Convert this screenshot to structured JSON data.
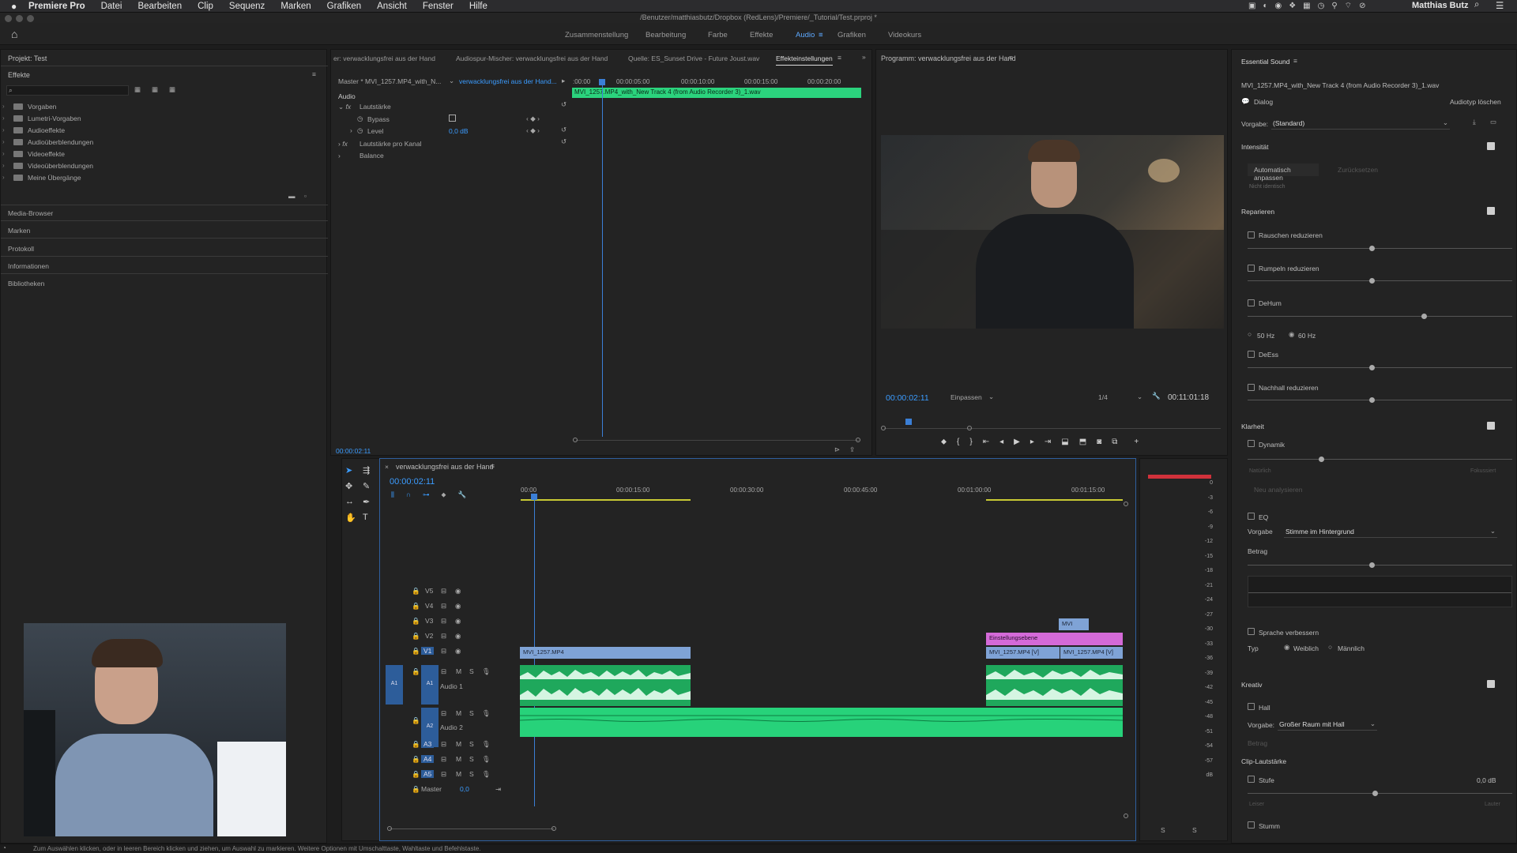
{
  "menubar": {
    "app": "Premiere Pro",
    "items": [
      "Datei",
      "Bearbeiten",
      "Clip",
      "Sequenz",
      "Marken",
      "Grafiken",
      "Ansicht",
      "Fenster",
      "Hilfe"
    ],
    "user": "Matthias Butz"
  },
  "titlebar": {
    "path": "/Benutzer/matthiasbutz/Dropbox (RedLens)/Premiere/_Tutorial/Test.prproj *"
  },
  "workspaces": [
    "Zusammenstellung",
    "Bearbeitung",
    "Farbe",
    "Effekte",
    "Audio",
    "Grafiken",
    "Videokurs"
  ],
  "workspace_active": "Audio",
  "project": {
    "title": "Projekt: Test",
    "effects_title": "Effekte"
  },
  "effects_tree": [
    "Vorgaben",
    "Lumetri-Vorgaben",
    "Audioeffekte",
    "Audioüberblendungen",
    "Videoeffekte",
    "Videoüberblendungen",
    "Meine Übergänge"
  ],
  "side_links": [
    "Media-Browser",
    "Marken",
    "Protokoll",
    "Informationen",
    "Bibliotheken"
  ],
  "source_tabs": [
    "er: verwacklungsfrei aus der Hand",
    "Audiospur-Mischer: verwacklungsfrei aus der Hand",
    "Quelle: ES_Sunset Drive - Future Joust.wav",
    "Effekteinstellungen"
  ],
  "effect_controls": {
    "master": "Master * MVI_1257.MP4_with_N...",
    "seq": "verwacklungsfrei aus der Hand...",
    "section": "Audio",
    "fx": "Lautstärke",
    "bypass": "Bypass",
    "level": "Level",
    "level_value": "0,0 dB",
    "per_channel": "Lautstärke pro Kanal",
    "balance": "Balance",
    "ruler": [
      ":00:00",
      "00:00:05:00",
      "00:00:10:00",
      "00:00:15:00",
      "00:00:20:00"
    ],
    "clip": "MVI_1257.MP4_with_New Track 4 (from Audio Recorder 3)_1.wav",
    "timecode": "00:00:02:11"
  },
  "program": {
    "title": "Programm: verwacklungsfrei aus der Hand",
    "timecode": "00:00:02:11",
    "fit": "Einpassen",
    "quality": "1/4",
    "duration": "00:11:01:18"
  },
  "timeline": {
    "tab": "verwacklungsfrei aus der Hand",
    "timecode": "00:00:02:11",
    "ruler": [
      "00:00",
      "00:00:15:00",
      "00:00:30:00",
      "00:00:45:00",
      "00:01:00:00",
      "00:01:15:00"
    ],
    "video_tracks": [
      "V5",
      "V4",
      "V3",
      "V2",
      "V1"
    ],
    "audio_tracks": [
      "A1",
      "A2",
      "A3",
      "A4",
      "A5"
    ],
    "audio1_name": "Audio 1",
    "audio2_name": "Audio 2",
    "master": "Master",
    "master_val": "0,0",
    "clip_v1a": "MVI_1257.MP4",
    "clip_adjust": "Einstellungsebene",
    "clip_v1b": "MVI_1257.MP4 [V]",
    "clip_v1c": "MVI_1257.MP4 [V]",
    "clip_v3": "MVI",
    "track_btn_m": "M",
    "track_btn_s": "S"
  },
  "meter": {
    "scale": [
      "0",
      "-3",
      "-6",
      "-9",
      "-12",
      "-15",
      "-18",
      "-21",
      "-24",
      "-27",
      "-30",
      "-33",
      "-36",
      "-39",
      "-42",
      "-45",
      "-48",
      "-51",
      "-54",
      "-57",
      "dB"
    ],
    "footer": [
      "S",
      "S"
    ]
  },
  "essential_sound": {
    "title": "Essential Sound",
    "file": "MVI_1257.MP4_with_New Track 4 (from Audio Recorder 3)_1.wav",
    "type": "Dialog",
    "clear_type": "Audiotyp löschen",
    "preset_label": "Vorgabe:",
    "preset_value": "(Standard)",
    "loudness": "Intensität",
    "auto_match": "Automatisch anpassen",
    "reset": "Zurücksetzen",
    "not_identified": "Nicht identisch",
    "repair": "Reparieren",
    "repair_items": [
      "Rauschen reduzieren",
      "Rumpeln reduzieren",
      "DeHum",
      "DeEss",
      "Nachhall reduzieren"
    ],
    "hz50": "50 Hz",
    "hz60": "60 Hz",
    "clarity": "Klarheit",
    "dynamics": "Dynamik",
    "natural": "Natürlich",
    "focused": "Fokussiert",
    "reset_dyn": "Neu analysieren",
    "eq": "EQ",
    "eq_preset_label": "Vorgabe",
    "eq_preset": "Stimme im Hintergrund",
    "amount": "Betrag",
    "enhance": "Sprache verbessern",
    "type_label": "Typ",
    "female": "Weiblich",
    "male": "Männlich",
    "creative": "Kreativ",
    "reverb": "Hall",
    "reverb_preset_label": "Vorgabe:",
    "reverb_preset": "Großer Raum mit Hall",
    "amount2": "Betrag",
    "clip_volume": "Clip-Lautstärke",
    "level": "Stufe",
    "level_val": "0,0 dB",
    "lower": "Leiser",
    "louder": "Lauter",
    "mute": "Stumm"
  },
  "status": "Zum Auswählen klicken, oder in leeren Bereich klicken und ziehen, um Auswahl zu markieren. Weitere Optionen mit Umschalttaste, Wahltaste und Befehlstaste.",
  "colors": {
    "accent": "#3b9cff",
    "audio_clip": "#2bd37d",
    "video_clip": "#7fa3d6",
    "adjust_clip": "#d46ad8"
  }
}
